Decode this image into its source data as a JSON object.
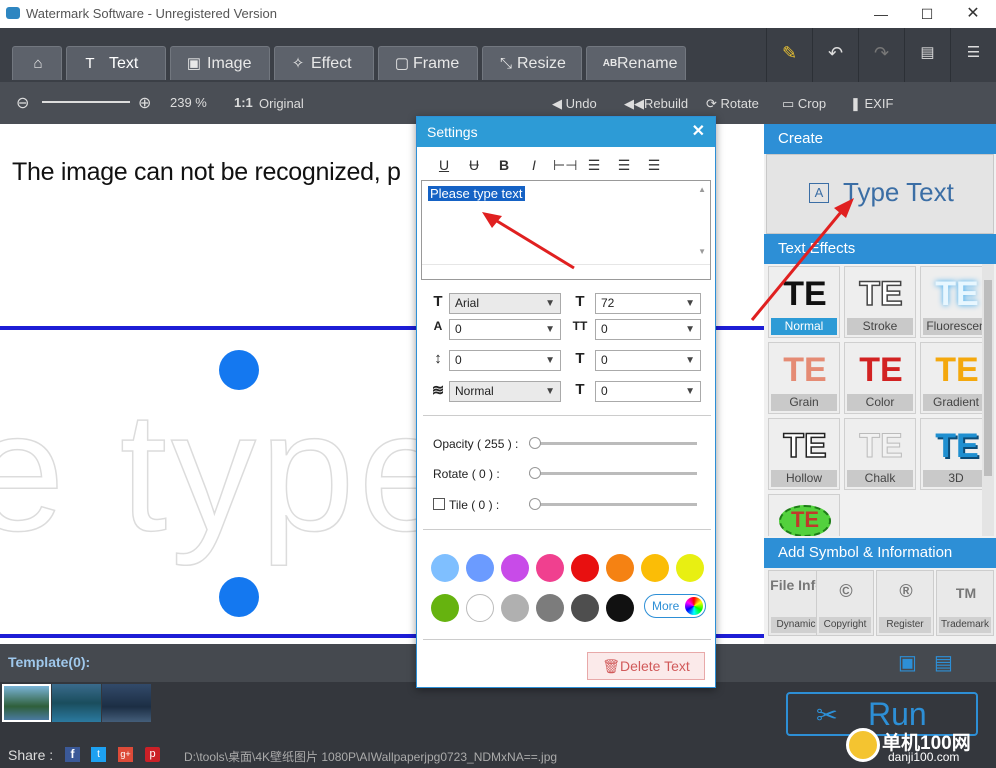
{
  "window": {
    "title": "Watermark Software - Unregistered Version"
  },
  "tabs": [
    {
      "label": "",
      "icon": "home-icon"
    },
    {
      "label": "Text",
      "icon": "text-icon"
    },
    {
      "label": "Image",
      "icon": "image-icon"
    },
    {
      "label": "Effect",
      "icon": "effect-icon"
    },
    {
      "label": "Frame",
      "icon": "frame-icon"
    },
    {
      "label": "Resize",
      "icon": "resize-icon"
    },
    {
      "label": "Rename",
      "icon": "rename-icon"
    }
  ],
  "toolbar": {
    "zoom": "239 %",
    "ratio_glyph": "1:1",
    "original": "Original",
    "undo": "Undo",
    "rebuild": "Rebuild",
    "rotate": "Rotate",
    "crop": "Crop",
    "exif": "EXIF"
  },
  "canvas": {
    "message": "The image can not be recognized, p",
    "watermark_text": "e type te"
  },
  "settings": {
    "title": "Settings",
    "text_value": "Please type text",
    "font": "Arial",
    "font_size": "72",
    "field_a": "0",
    "field_b": "0",
    "field_c": "0",
    "field_d": "0",
    "blend": "Normal",
    "field_e": "0",
    "opacity_label": "Opacity ( 255 ) :",
    "rotate_label": "Rotate ( 0 ) :",
    "tile_label": "Tile ( 0 ) :",
    "opacity": 1.0,
    "rotate": 0,
    "tile": 0,
    "more": "More",
    "delete": "Delete Text",
    "colors": [
      "#7fbfff",
      "#6b9bff",
      "#c84be8",
      "#f0408f",
      "#e81010",
      "#f58213",
      "#fbbd06",
      "#e8ef12",
      "#66b30f",
      "#ffffff",
      "#b0b0b0",
      "#7c7c7c",
      "#4e4e4e",
      "#111111"
    ]
  },
  "right": {
    "create": "Create",
    "type_text": "Type Text",
    "effects_header": "Text Effects",
    "effects": [
      {
        "glyph": "TE",
        "name": "Normal",
        "color": "#111111"
      },
      {
        "glyph": "TE",
        "name": "Stroke",
        "color": "#555555"
      },
      {
        "glyph": "TE",
        "name": "Fluorescen",
        "color": "#6fc4f5"
      },
      {
        "glyph": "TE",
        "name": "Grain",
        "color": "#e06d5d"
      },
      {
        "glyph": "TE",
        "name": "Color",
        "color": "#d22222"
      },
      {
        "glyph": "TE",
        "name": "Gradient",
        "color": "#f3a30b"
      },
      {
        "glyph": "TE",
        "name": "Hollow",
        "color": "#444444"
      },
      {
        "glyph": "TE",
        "name": "Chalk",
        "color": "#cfcfcf"
      },
      {
        "glyph": "TE",
        "name": "3D",
        "color": "#1f8fd0"
      },
      {
        "glyph": "TE",
        "name": "",
        "color": "#c0392b"
      }
    ],
    "symbol_header": "Add Symbol & Information",
    "symbols": [
      {
        "glyph": "File Info",
        "name": "Dynamic"
      },
      {
        "glyph": "©",
        "name": "Copyright"
      },
      {
        "glyph": "®",
        "name": "Register"
      },
      {
        "glyph": "TM",
        "name": "Trademark"
      }
    ]
  },
  "bottom": {
    "template": "Template(0):",
    "share": "Share :",
    "path": "D:\\tools\\桌面\\4K壁纸图片 1080P\\AIWallpaperjpg0723_NDMxNA==.jpg",
    "run": "Run",
    "watermark_site": "单机100网",
    "watermark_url": "danji100.com"
  }
}
